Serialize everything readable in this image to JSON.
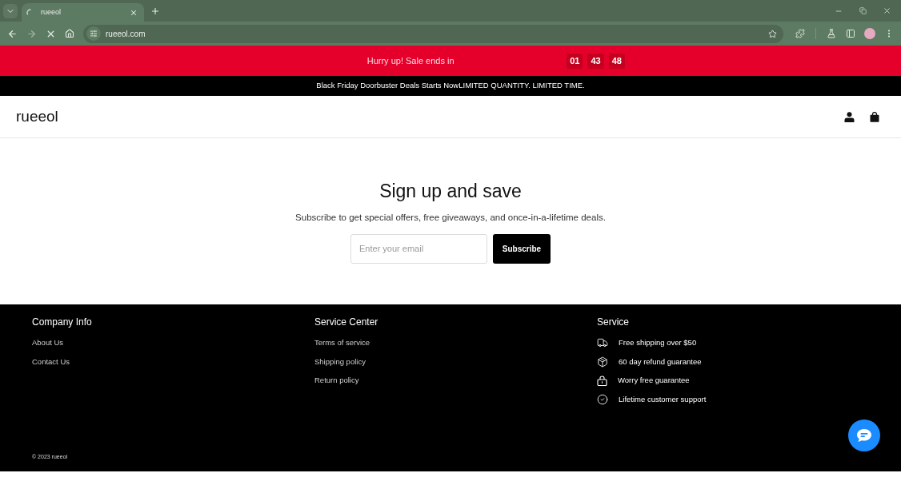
{
  "browser": {
    "tab": {
      "title": "rueeol"
    },
    "address": "rueeol.com"
  },
  "announcement": {
    "text": "Hurry up! Sale ends in",
    "countdown": [
      "01",
      "43",
      "48"
    ]
  },
  "promo_bar": {
    "text": "Black Friday Doorbuster Deals Starts NowLIMITED QUANTITY. LIMITED TIME."
  },
  "header": {
    "logo": "rueeol"
  },
  "signup": {
    "title": "Sign up and save",
    "subtitle": "Subscribe to get special offers, free giveaways, and once-in-a-lifetime deals.",
    "email": {
      "placeholder": "Enter your email"
    },
    "button": "Subscribe"
  },
  "footer": {
    "company_info": {
      "title": "Company Info",
      "links": [
        "About Us",
        "Contact Us"
      ]
    },
    "service_center": {
      "title": "Service Center",
      "links": [
        "Terms of service",
        "Shipping policy",
        "Return policy"
      ]
    },
    "service": {
      "title": "Service",
      "items": [
        "Free shipping over $50",
        "60 day refund guarantee",
        "Worry free guarantee",
        "Lifetime customer support"
      ]
    },
    "copyright": "© 2023 rueeol"
  }
}
